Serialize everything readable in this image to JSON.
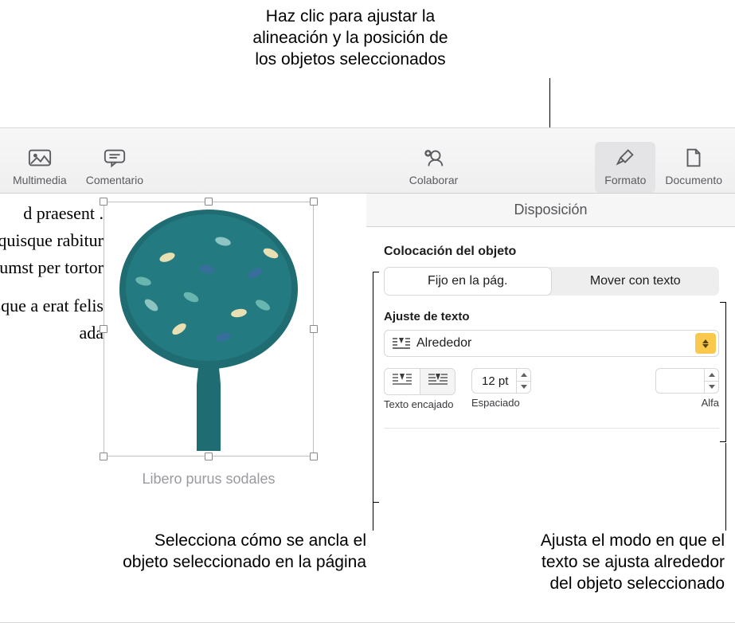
{
  "callouts": {
    "top": "Haz clic para ajustar la\nalineación y la posición de\nlos objetos seleccionados",
    "left": "Selecciona cómo se ancla el\nobjeto seleccionado en la página",
    "right": "Ajusta el modo en que el\ntexto se ajusta alrededor\ndel objeto seleccionado"
  },
  "toolbar": {
    "multimedia": "Multimedia",
    "comment": "Comentario",
    "collaborate": "Colaborar",
    "format": "Formato",
    "document": "Documento"
  },
  "inspector_tab": "Disposición",
  "document": {
    "para1": "d praesent . quisque rabitur dictumst per tortor",
    "para2": "esque a erat felis ada",
    "caption": "Libero purus sodales"
  },
  "panel": {
    "placement_title": "Colocación del objeto",
    "segment_fixed": "Fijo en la pág.",
    "segment_move": "Mover con texto",
    "wrap_title": "Ajuste de texto",
    "wrap_value": "Alrededor",
    "fit_label": "Texto encajado",
    "spacing_label": "Espaciado",
    "spacing_value": "12 pt",
    "alpha_label": "Alfa",
    "alpha_value": ""
  }
}
